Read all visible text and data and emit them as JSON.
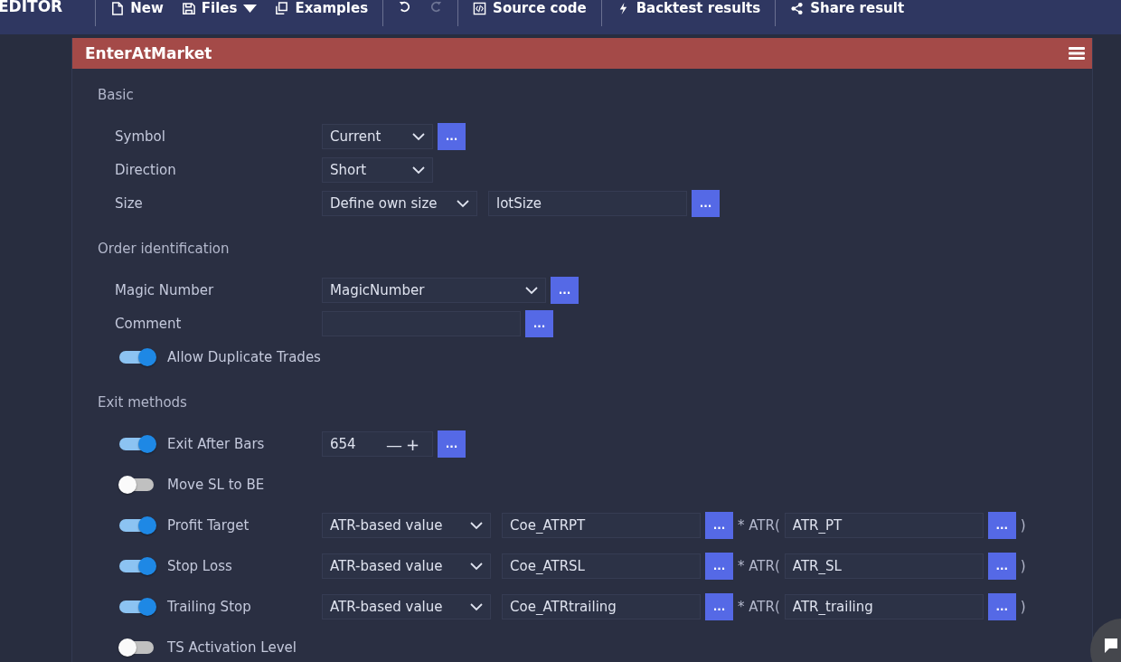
{
  "nav": {
    "brand": "EDITOR",
    "items": [
      {
        "label": "New",
        "disabled": false
      },
      {
        "label": "Files",
        "disabled": false
      },
      {
        "label": "Examples",
        "disabled": false
      },
      {
        "disabled": false
      },
      {
        "disabled": true
      },
      {
        "label": "Source code",
        "disabled": false
      },
      {
        "label": "Backtest results",
        "disabled": false
      },
      {
        "label": "Share result",
        "disabled": false
      }
    ]
  },
  "panel": {
    "title": "EnterAtMarket",
    "sections": [
      {
        "title": "Basic",
        "rows": [
          {
            "kind": "plain",
            "label": "Symbol",
            "controls": [
              {
                "kind": "select",
                "value": "Current"
              },
              {
                "kind": "dots",
                "text": "..."
              }
            ]
          },
          {
            "kind": "plain",
            "label": "Direction",
            "controls": [
              {
                "kind": "select",
                "value": "Short"
              }
            ]
          },
          {
            "kind": "plain",
            "label": "Size",
            "controls": [
              {
                "kind": "select",
                "value": "Define own size"
              },
              {
                "kind": "input",
                "value": "lotSize"
              },
              {
                "kind": "dots",
                "text": "..."
              }
            ]
          }
        ]
      },
      {
        "title": "Order identification",
        "rows": [
          {
            "kind": "plain",
            "label": "Magic Number",
            "controls": [
              {
                "kind": "select",
                "value": "MagicNumber"
              },
              {
                "kind": "dots",
                "text": "..."
              }
            ]
          },
          {
            "kind": "plain",
            "label": "Comment",
            "controls": [
              {
                "kind": "input"
              },
              {
                "kind": "dots",
                "text": "..."
              }
            ]
          },
          {
            "kind": "toggle",
            "label": "Allow Duplicate Trades",
            "on": true,
            "controls": []
          }
        ]
      },
      {
        "title": "Exit methods",
        "rows": [
          {
            "kind": "toggle",
            "label": "Exit After Bars",
            "on": true,
            "controls": [
              {
                "kind": "stepper",
                "value": "654",
                "minus": "—",
                "plus": "+"
              },
              {
                "kind": "dots",
                "text": "..."
              }
            ]
          },
          {
            "kind": "toggle",
            "label": "Move SL to BE",
            "on": false,
            "controls": []
          },
          {
            "kind": "toggle",
            "label": "Profit Target",
            "on": true,
            "controls": [
              {
                "kind": "select",
                "value": "ATR-based value"
              },
              {
                "kind": "input",
                "value": "Coe_ATRPT"
              },
              {
                "kind": "dots",
                "text": "..."
              },
              {
                "kind": "text",
                "text": "* ATR("
              },
              {
                "kind": "input",
                "value": "ATR_PT"
              },
              {
                "kind": "dots",
                "text": "..."
              },
              {
                "kind": "text",
                "text": ")"
              }
            ]
          },
          {
            "kind": "toggle",
            "label": "Stop Loss",
            "on": true,
            "controls": [
              {
                "kind": "select",
                "value": "ATR-based value"
              },
              {
                "kind": "input",
                "value": "Coe_ATRSL"
              },
              {
                "kind": "dots",
                "text": "..."
              },
              {
                "kind": "text",
                "text": "* ATR("
              },
              {
                "kind": "input",
                "value": "ATR_SL"
              },
              {
                "kind": "dots",
                "text": "..."
              },
              {
                "kind": "text",
                "text": ")"
              }
            ]
          },
          {
            "kind": "toggle",
            "label": "Trailing Stop",
            "on": true,
            "controls": [
              {
                "kind": "select",
                "value": "ATR-based value"
              },
              {
                "kind": "input",
                "value": "Coe_ATRtrailing"
              },
              {
                "kind": "dots",
                "text": "..."
              },
              {
                "kind": "text",
                "text": "* ATR("
              },
              {
                "kind": "input",
                "value": "ATR_trailing"
              },
              {
                "kind": "dots",
                "text": "..."
              },
              {
                "kind": "text",
                "text": ")"
              }
            ]
          },
          {
            "kind": "toggle",
            "label": "TS Activation Level",
            "on": false,
            "controls": []
          }
        ]
      }
    ]
  }
}
